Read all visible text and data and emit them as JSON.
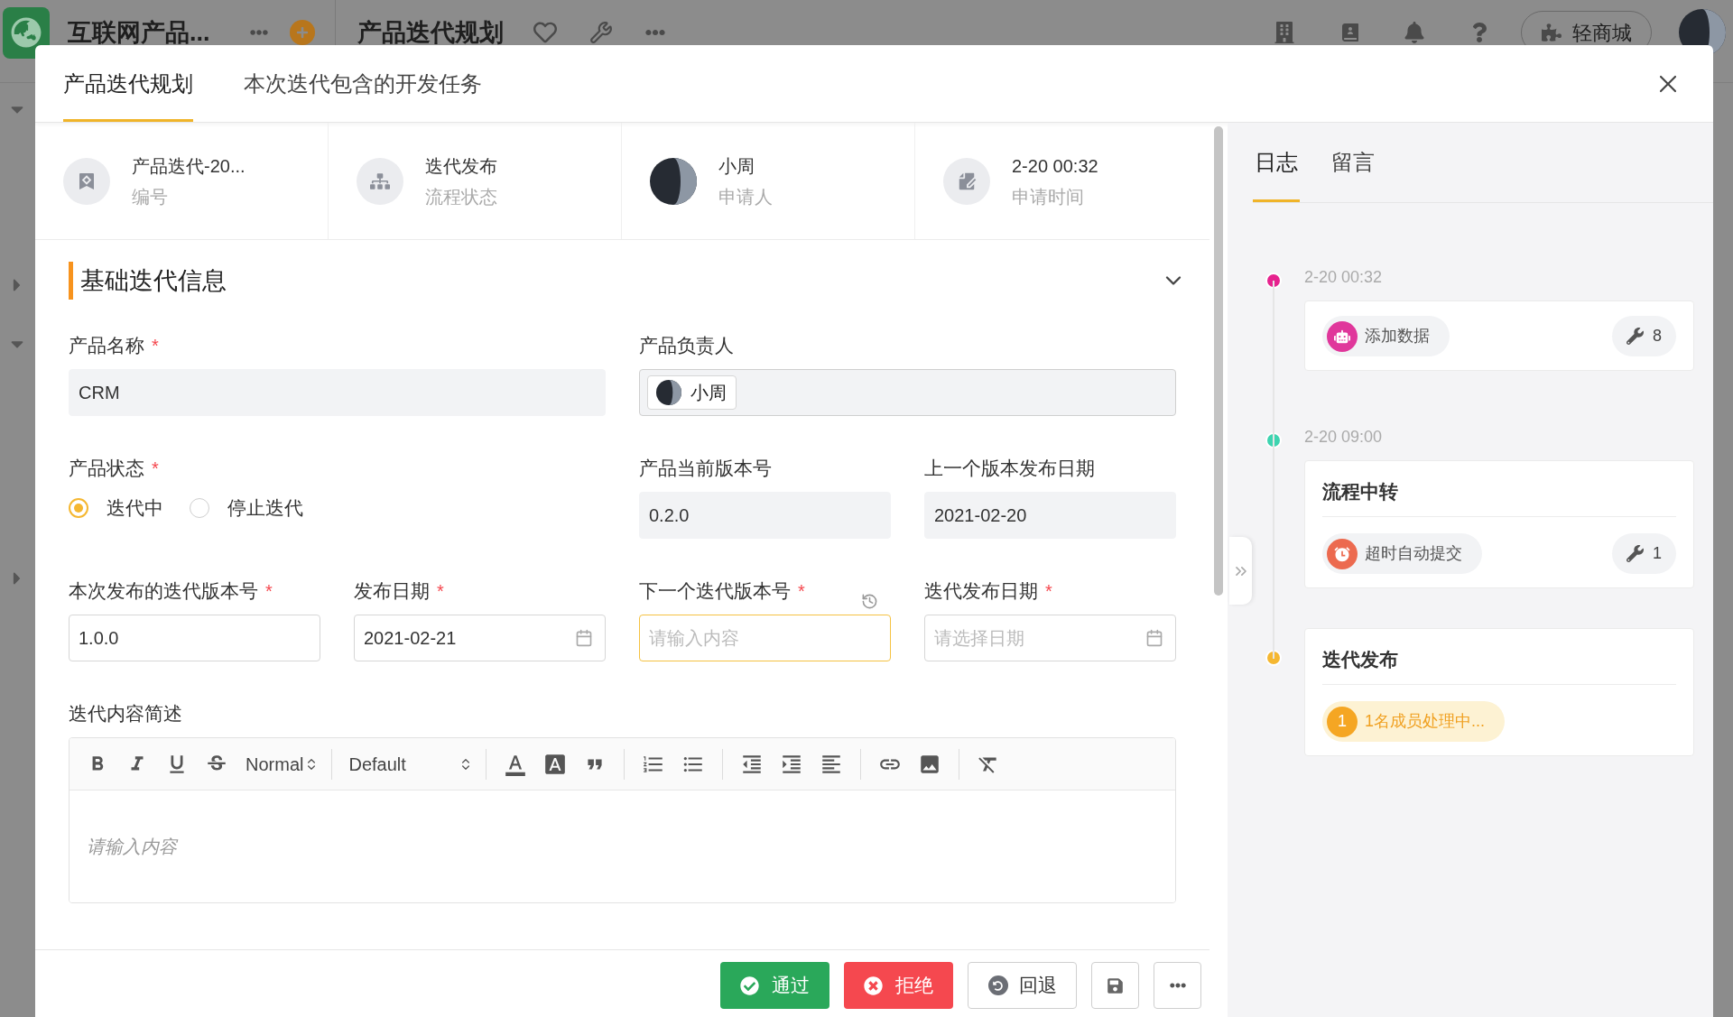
{
  "app_bar": {
    "workspace": "互联网产品...",
    "page_title": "产品迭代规划",
    "store_button": "轻商城"
  },
  "dialog": {
    "tabs": [
      {
        "label": "产品迭代规划",
        "selected": true
      },
      {
        "label": "本次迭代包含的开发任务",
        "selected": false
      }
    ],
    "summary": [
      {
        "kind": "number",
        "value": "产品迭代-20...",
        "caption": "编号"
      },
      {
        "kind": "flow",
        "value": "迭代发布",
        "caption": "流程状态"
      },
      {
        "kind": "applicant",
        "value": "小周",
        "caption": "申请人"
      },
      {
        "kind": "time",
        "value": "2-20 00:32",
        "caption": "申请时间"
      }
    ],
    "section": {
      "title": "基础迭代信息",
      "expanded": true
    },
    "fields": [
      {
        "kind": "text",
        "label": "产品名称",
        "required_mark": "*",
        "value": "CRM",
        "readonly": true
      },
      {
        "kind": "user",
        "label": "产品负责人",
        "value": "小周"
      },
      {
        "kind": "radio",
        "label": "产品状态",
        "required_mark": "*",
        "options": [
          {
            "label": "迭代中",
            "selected": true
          },
          {
            "label": "停止迭代",
            "selected": false
          }
        ]
      },
      {
        "kind": "text",
        "label": "产品当前版本号",
        "value": "0.2.0",
        "readonly": true
      },
      {
        "kind": "text",
        "label": "上一个版本发布日期",
        "value": "2021-02-20",
        "readonly": true
      },
      {
        "kind": "text",
        "label": "本次发布的迭代版本号",
        "required_mark": "*",
        "value": "1.0.0",
        "readonly": false
      },
      {
        "kind": "date",
        "label": "发布日期",
        "required_mark": "*",
        "value": "2021-02-21"
      },
      {
        "kind": "text",
        "label": "下一个迭代版本号",
        "required_mark": "*",
        "placeholder": "请输入内容",
        "readonly": false,
        "focused": true,
        "history": true
      },
      {
        "kind": "date",
        "label": "迭代发布日期",
        "required_mark": "*",
        "placeholder": "请选择日期"
      },
      {
        "kind": "richtext",
        "label": "迭代内容简述",
        "placeholder": "请输入内容",
        "header_select": "Normal",
        "font_select": "Default"
      }
    ],
    "actions": [
      {
        "kind": "approve",
        "label": "通过"
      },
      {
        "kind": "reject",
        "label": "拒绝"
      },
      {
        "kind": "return",
        "label": "回退"
      },
      {
        "kind": "save"
      },
      {
        "kind": "more"
      }
    ]
  },
  "side_panel": {
    "tabs": [
      {
        "label": "日志",
        "selected": true
      },
      {
        "label": "留言",
        "selected": false
      }
    ],
    "log": [
      {
        "color": "#e6228e",
        "time": "2-20 00:32",
        "action": {
          "kind": "robot",
          "label": "添加数据"
        },
        "count": "8"
      },
      {
        "color": "#3dd4b0",
        "time": "2-20 09:00",
        "title": "流程中转",
        "action": {
          "kind": "alarm",
          "label": "超时自动提交"
        },
        "count": "1"
      },
      {
        "color": "#f5b731",
        "title": "迭代发布",
        "pending": {
          "count": "1",
          "label": "1名成员处理中..."
        }
      }
    ]
  }
}
